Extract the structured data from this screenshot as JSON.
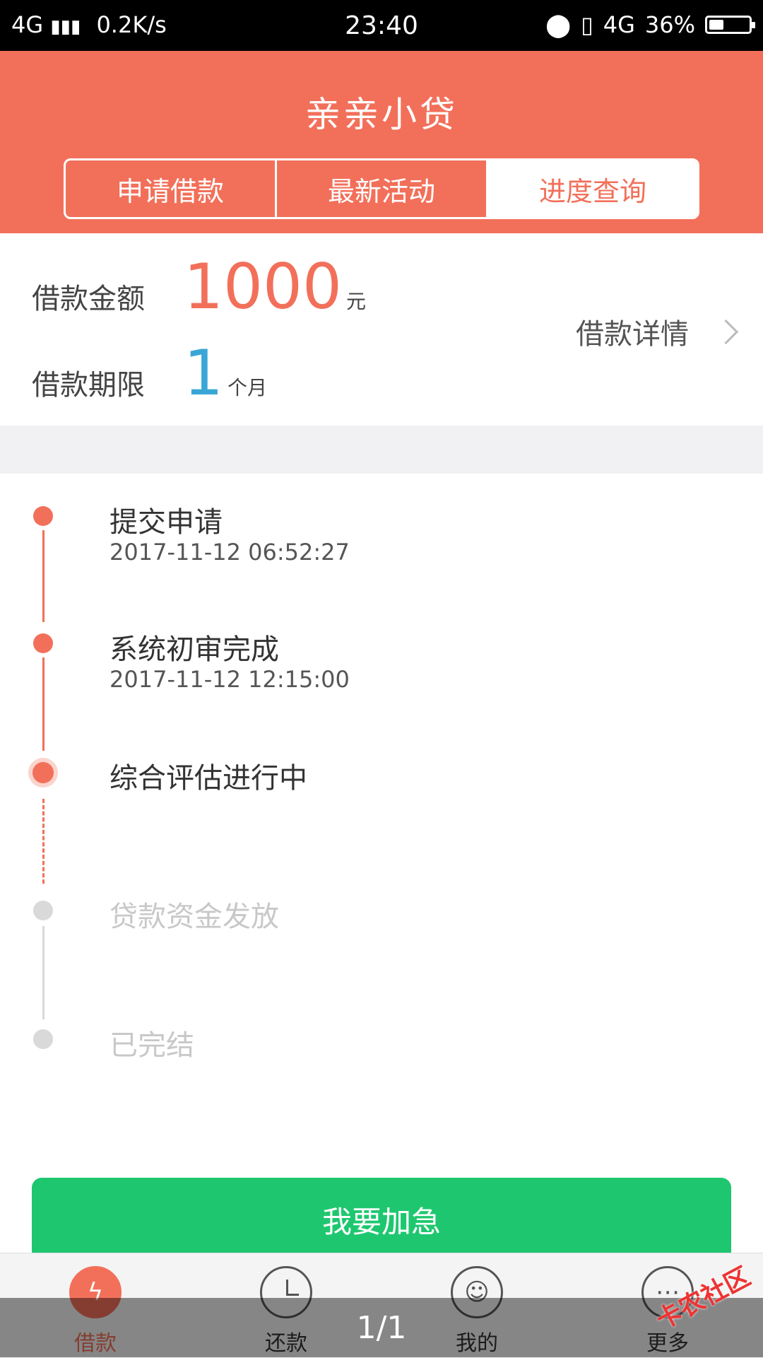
{
  "status_bar": {
    "network": "4G",
    "signal_icon": "signal-bars-icon",
    "speed": "0.2K/s",
    "time": "23:40",
    "location_icon": "location-pin-icon",
    "vibrate_icon": "vibrate-icon",
    "network_right": "4G",
    "battery_percent": "36%",
    "battery_level": 0.36
  },
  "header": {
    "title": "亲亲小贷",
    "tabs": [
      {
        "label": "申请借款",
        "active": false
      },
      {
        "label": "最新活动",
        "active": false
      },
      {
        "label": "进度查询",
        "active": true
      }
    ]
  },
  "summary": {
    "amount_label": "借款金额",
    "amount_value": "1000",
    "amount_unit": "元",
    "term_label": "借款期限",
    "term_value": "1",
    "term_unit": "个月",
    "detail_link": "借款详情",
    "detail_icon": "chevron-right-icon"
  },
  "timeline": {
    "steps": [
      {
        "title": "提交申请",
        "time": "2017-11-12 06:52:27",
        "status": "done"
      },
      {
        "title": "系统初审完成",
        "time": "2017-11-12 12:15:00",
        "status": "done"
      },
      {
        "title": "综合评估进行中",
        "time": "",
        "status": "current"
      },
      {
        "title": "贷款资金发放",
        "time": "",
        "status": "pending"
      },
      {
        "title": "已完结",
        "time": "",
        "status": "pending"
      }
    ]
  },
  "cta": {
    "label": "我要加急"
  },
  "bottom_nav": {
    "items": [
      {
        "label": "借款",
        "icon": "lightning-icon",
        "active": true
      },
      {
        "label": "还款",
        "icon": "clock-icon",
        "active": false
      },
      {
        "label": "我的",
        "icon": "smiley-icon",
        "active": false
      },
      {
        "label": "更多",
        "icon": "more-dots-icon",
        "active": false
      }
    ]
  },
  "overlay": {
    "pager": "1/1",
    "watermark": "卡农社区"
  },
  "colors": {
    "accent": "#f2705a",
    "term": "#3aa6d6",
    "cta": "#1ec76f"
  }
}
